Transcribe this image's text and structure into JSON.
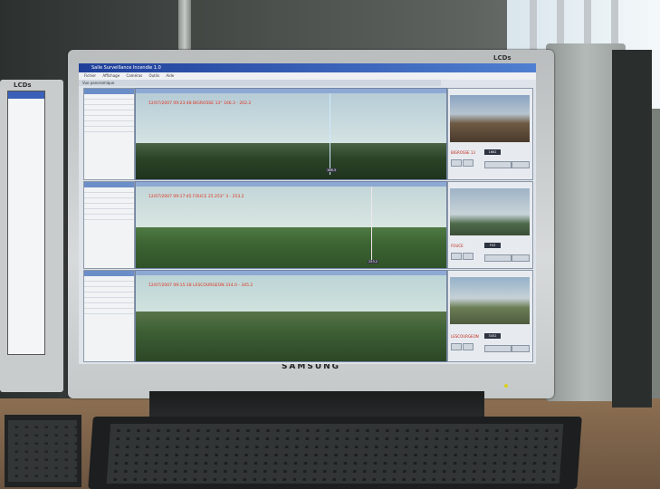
{
  "scene": {
    "left_monitor_logo": "LCDs",
    "main_monitor_logo": "LCDs",
    "brand": "SAMSUNG"
  },
  "app": {
    "title": "Salle Surveillance Incendie 1.0",
    "menu": [
      "Fichier",
      "Affichage",
      "Caméras",
      "Outils",
      "Aide"
    ],
    "tab": "Vue panoramique"
  },
  "views": [
    {
      "overlay": "12/07/2007 09:23:48 BIGROSSE 13° 166.3 - 202.2",
      "bearing_label": "166.3"
    },
    {
      "overlay": "12/07/2007 09:17:45 FOUCE 25.253° 3 - 253.2",
      "bearing_label": "253.2"
    },
    {
      "overlay": "12/07/2007 09:15:18 LESCOURGEON 314.0 - 345.2",
      "bearing_label": ""
    }
  ],
  "cameras": [
    {
      "label": "BIGROSSE 13",
      "value": "1662"
    },
    {
      "label": "FOUCE",
      "value": "FS3"
    },
    {
      "label": "LESCOURGEON",
      "value": "3452"
    }
  ],
  "colors": {
    "title_bar": "#2e55b0",
    "overlay_text": "#e0301e",
    "sky": "#c9dce0",
    "forest": "#2f4a2b"
  }
}
